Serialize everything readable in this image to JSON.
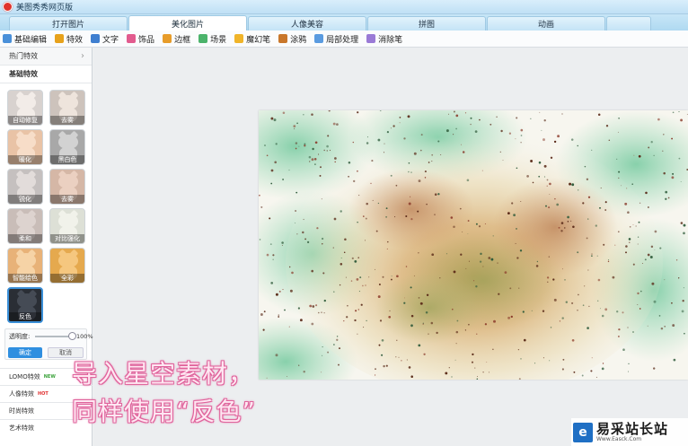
{
  "window": {
    "title": "美图秀秀网页版"
  },
  "tabs": [
    {
      "label": "打开图片",
      "active": false
    },
    {
      "label": "美化图片",
      "active": true
    },
    {
      "label": "人像美容",
      "active": false
    },
    {
      "label": "拼图",
      "active": false
    },
    {
      "label": "动画",
      "active": false
    }
  ],
  "toolbar": [
    {
      "label": "基础编辑",
      "icon": "edit-icon",
      "color": "#4a90d9"
    },
    {
      "label": "特效",
      "icon": "magic-wand-icon",
      "color": "#e7a21c"
    },
    {
      "label": "文字",
      "icon": "text-icon",
      "color": "#3f7fd0"
    },
    {
      "label": "饰品",
      "icon": "bow-icon",
      "color": "#e25b8e"
    },
    {
      "label": "边框",
      "icon": "frame-icon",
      "color": "#e79c2a"
    },
    {
      "label": "场景",
      "icon": "scene-icon",
      "color": "#4bb36b"
    },
    {
      "label": "魔幻笔",
      "icon": "magic-pen-icon",
      "color": "#f0b429"
    },
    {
      "label": "涂鸦",
      "icon": "brush-icon",
      "color": "#c9772b"
    },
    {
      "label": "局部处理",
      "icon": "local-adjust-icon",
      "color": "#5a9be0"
    },
    {
      "label": "消除笔",
      "icon": "eraser-icon",
      "color": "#9a7ad6"
    }
  ],
  "left_panel": {
    "hot_effects": "热门特效",
    "basic_effects": "基础特效",
    "effects": [
      {
        "label": "自动修复",
        "bg": "#d8d2cf",
        "cat": "#f2ece8"
      },
      {
        "label": "去雾",
        "bg": "#cdc3bc",
        "cat": "#eee4dc"
      },
      {
        "label": "暖化",
        "bg": "#e9c3a6",
        "cat": "#f7ddc8"
      },
      {
        "label": "黑白色",
        "bg": "#a8a8a8",
        "cat": "#d2d2d2"
      },
      {
        "label": "锐化",
        "bg": "#c5c0bf",
        "cat": "#e2dcda"
      },
      {
        "label": "去雾",
        "bg": "#d5b7a6",
        "cat": "#ebd0c1"
      },
      {
        "label": "柔和",
        "bg": "#c9bdb8",
        "cat": "#ddd3cf"
      },
      {
        "label": "对比强化",
        "bg": "#dde0d6",
        "cat": "#f1f2ea"
      },
      {
        "label": "智能绘色",
        "bg": "#e8b278",
        "cat": "#f6d3a6"
      },
      {
        "label": "全彩",
        "bg": "#e5a94e",
        "cat": "#f5c77f"
      },
      {
        "label": "反色",
        "bg": "#2a2e35",
        "cat": "#454b55"
      }
    ],
    "opacity": {
      "label": "透明度:",
      "value": "100%",
      "level": 1.0
    },
    "confirm_label": "确定",
    "cancel_label": "取消",
    "categories": [
      {
        "label": "LOMO特效",
        "badge": "NEW",
        "badge_color": "#3aa23a"
      },
      {
        "label": "人像特效",
        "badge": "HOT",
        "badge_color": "#e03030"
      },
      {
        "label": "时尚特效",
        "badge": "",
        "badge_color": ""
      },
      {
        "label": "艺术特效",
        "badge": "",
        "badge_color": ""
      }
    ]
  },
  "overlay": {
    "line1": "导入星空素材，",
    "line2": "同样使用“反色”"
  },
  "watermark": {
    "logo": "e",
    "name": "易采站长站",
    "url": "Www.Easck.Com"
  }
}
